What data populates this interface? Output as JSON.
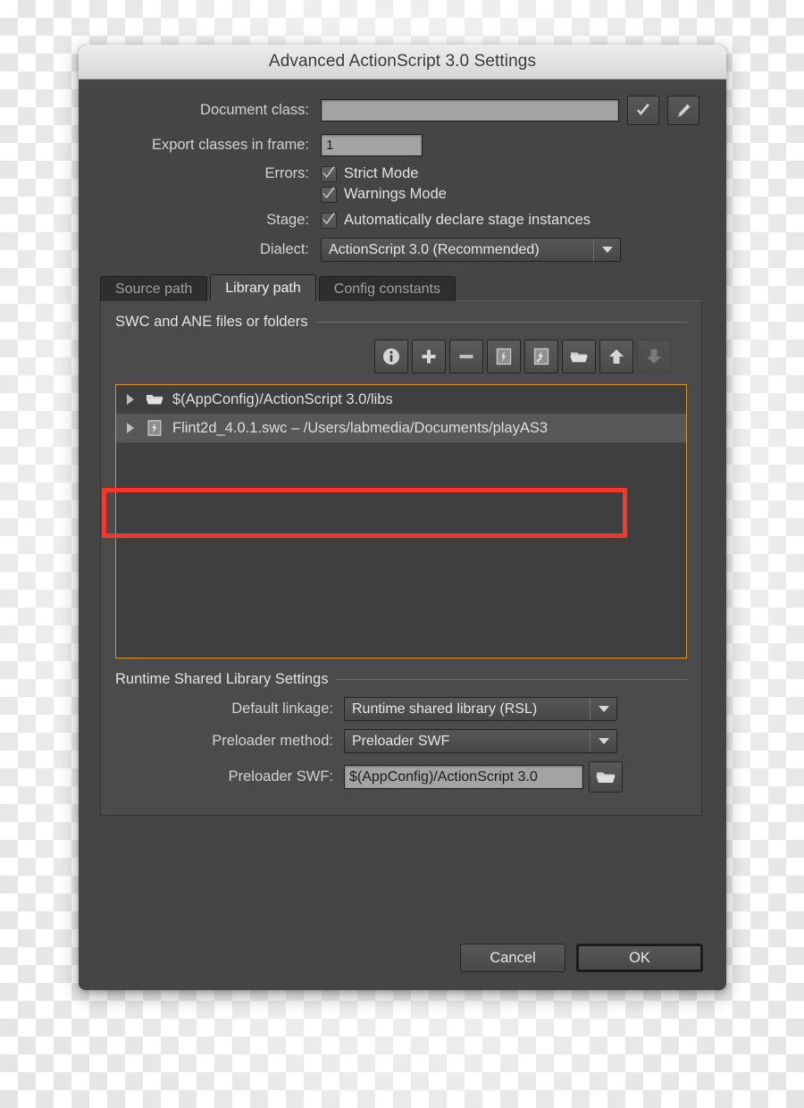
{
  "window": {
    "title": "Advanced ActionScript 3.0 Settings"
  },
  "form": {
    "document_class": {
      "label": "Document class:",
      "value": "",
      "placeholder": "",
      "check_button": "check-icon",
      "edit_button": "pencil-icon"
    },
    "export_frame": {
      "label": "Export classes in frame:",
      "value": "1"
    },
    "errors": {
      "label": "Errors:",
      "options": [
        {
          "label": "Strict Mode",
          "checked": true
        },
        {
          "label": "Warnings Mode",
          "checked": true
        }
      ]
    },
    "stage": {
      "label": "Stage:",
      "options": [
        {
          "label": "Automatically declare stage instances",
          "checked": true
        }
      ]
    },
    "dialect": {
      "label": "Dialect:",
      "value": "ActionScript 3.0 (Recommended)"
    }
  },
  "tabs": [
    {
      "label": "Source path",
      "active": false
    },
    {
      "label": "Library path",
      "active": true
    },
    {
      "label": "Config constants",
      "active": false
    }
  ],
  "library_panel": {
    "group_title": "SWC and ANE files or folders",
    "toolbar": [
      {
        "name": "info-icon",
        "label": "Info",
        "disabled": false
      },
      {
        "name": "plus-icon",
        "label": "Add",
        "disabled": false
      },
      {
        "name": "minus-icon",
        "label": "Remove",
        "disabled": false
      },
      {
        "name": "swc-file-icon",
        "label": "Browse to SWC file",
        "disabled": false
      },
      {
        "name": "ane-file-icon",
        "label": "Browse to ANE file",
        "disabled": false
      },
      {
        "name": "folder-icon",
        "label": "Browse to folder",
        "disabled": false
      },
      {
        "name": "arrow-up-icon",
        "label": "Move up",
        "disabled": false
      },
      {
        "name": "arrow-down-icon",
        "label": "Move down",
        "disabled": true
      }
    ],
    "items": [
      {
        "text": "$(AppConfig)/ActionScript 3.0/libs",
        "icon": "folder-icon",
        "selected": false
      },
      {
        "text": "Flint2d_4.0.1.swc – /Users/labmedia/Documents/playAS3",
        "icon": "swc-file-icon",
        "selected": true
      }
    ]
  },
  "runtime_shared_library": {
    "group_title": "Runtime Shared Library Settings",
    "default_linkage": {
      "label": "Default linkage:",
      "value": "Runtime shared library (RSL)"
    },
    "preloader_method": {
      "label": "Preloader method:",
      "value": "Preloader SWF"
    },
    "preloader_swf": {
      "label": "Preloader SWF:",
      "value": "$(AppConfig)/ActionScript 3.0",
      "browse_button": "folder-icon"
    }
  },
  "footer": {
    "cancel_label": "Cancel",
    "ok_label": "OK"
  },
  "colors": {
    "dialog_bg": "#454545",
    "panel_bg": "#4b4b4b",
    "listbox_border": "#d79b25",
    "annotation": "#f8352f",
    "title_text": "#3a3a3a"
  }
}
